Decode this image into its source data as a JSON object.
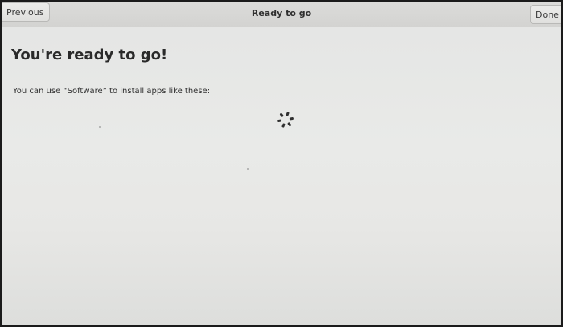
{
  "header": {
    "title": "Ready to go",
    "previous_label": "Previous",
    "done_label": "Done"
  },
  "main": {
    "title": "You're ready to go!",
    "subtitle": "You can use “Software” to install apps like these:",
    "loading_icon": "spinner-icon"
  },
  "colors": {
    "background": "#e7e8e6",
    "headerbar": "#d6d6d4",
    "text": "#2b2b2b"
  }
}
